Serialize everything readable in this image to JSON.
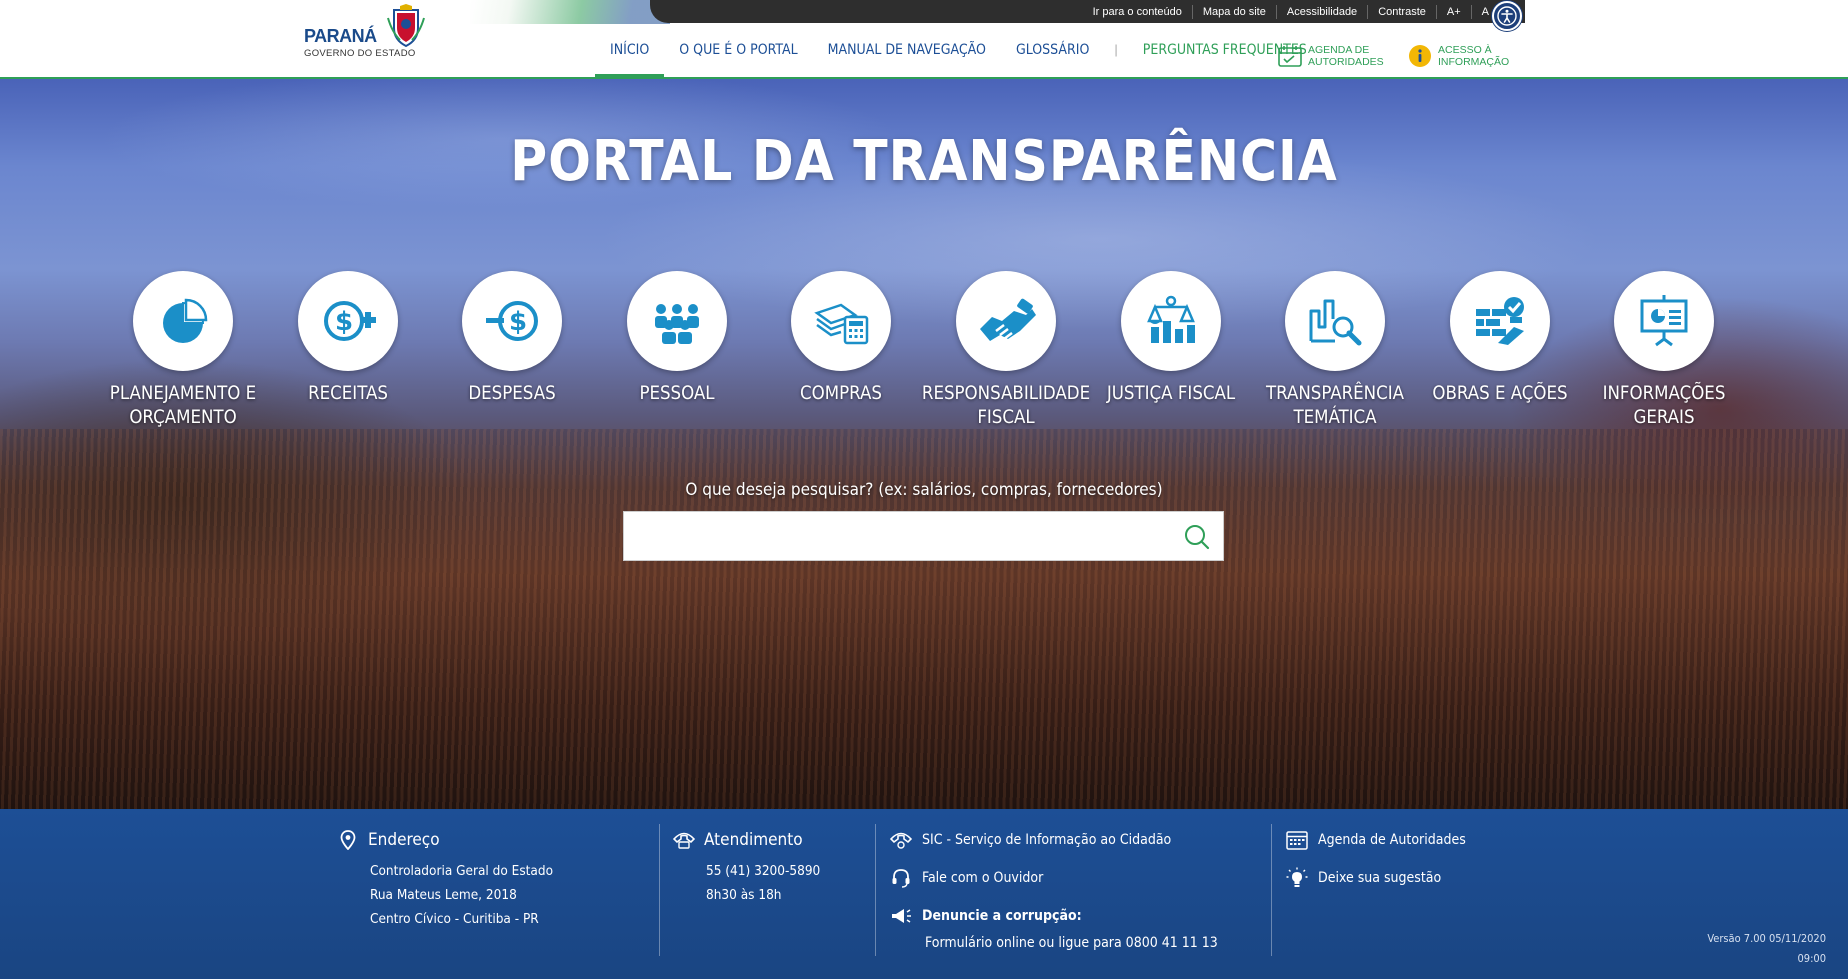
{
  "header": {
    "logo": {
      "title": "PARANÁ",
      "subtitle": "GOVERNO DO ESTADO"
    },
    "topbar_links": [
      "Ir para o conteúdo",
      "Mapa do site",
      "Acessibilidade",
      "Contraste",
      "A+",
      "A"
    ],
    "nav": [
      {
        "label": "INÍCIO",
        "active": true
      },
      {
        "label": "O QUE É O PORTAL"
      },
      {
        "label": "MANUAL DE NAVEGAÇÃO"
      },
      {
        "label": "GLOSSÁRIO"
      }
    ],
    "nav_separator": "|",
    "faq_label": "PERGUNTAS FREQUENTES",
    "agenda": {
      "line1": "AGENDA DE",
      "line2": "AUTORIDADES"
    },
    "acesso": {
      "line1": "ACESSO À",
      "line2": "INFORMAÇÃO"
    }
  },
  "hero": {
    "title": "PORTAL DA TRANSPARÊNCIA",
    "categories": [
      {
        "line1": "PLANEJAMENTO E",
        "line2": "ORÇAMENTO",
        "icon": "pie-chart-icon"
      },
      {
        "line1": "RECEITAS",
        "line2": "",
        "icon": "dollar-plus-icon"
      },
      {
        "line1": "DESPESAS",
        "line2": "",
        "icon": "dollar-minus-icon"
      },
      {
        "line1": "PESSOAL",
        "line2": "",
        "icon": "people-icon"
      },
      {
        "line1": "COMPRAS",
        "line2": "",
        "icon": "money-calculator-icon"
      },
      {
        "line1": "RESPONSABILIDADE",
        "line2": "FISCAL",
        "icon": "handshake-icon"
      },
      {
        "line1": "JUSTIÇA FISCAL",
        "line2": "",
        "icon": "scales-icon"
      },
      {
        "line1": "TRANSPARÊNCIA",
        "line2": "TEMÁTICA",
        "icon": "chart-magnifier-icon"
      },
      {
        "line1": "OBRAS E AÇÕES",
        "line2": "",
        "icon": "bricks-check-icon"
      },
      {
        "line1": "INFORMAÇÕES",
        "line2": "GERAIS",
        "icon": "presentation-board-icon"
      }
    ],
    "search_prompt": "O que deseja pesquisar? (ex: salários, compras, fornecedores)",
    "search_value": "",
    "search_placeholder": ""
  },
  "footer": {
    "endereco": {
      "title": "Endereço",
      "lines": [
        "Controladoria Geral do Estado",
        "Rua Mateus Leme, 2018",
        "Centro Cívico - Curitiba - PR"
      ]
    },
    "atendimento": {
      "title": "Atendimento",
      "lines": [
        "55 (41) 3200-5890",
        "8h30 às 18h"
      ]
    },
    "links": {
      "sic": "SIC - Serviço de Informação ao Cidadão",
      "ouvidor": "Fale com o Ouvidor",
      "denuncie_title": "Denuncie a corrupção:",
      "denuncie_text": "Formulário online ou ligue para 0800 41 11 13",
      "agenda": "Agenda de Autoridades",
      "sugestao": "Deixe sua sugestão"
    },
    "version": "Versão 7.00 05/11/2020",
    "time": "09:00"
  },
  "colors": {
    "primary_blue": "#1d4f96",
    "green": "#2f9f58",
    "icon_blue": "#1b8fc8",
    "topbar": "#2e2e2e"
  }
}
